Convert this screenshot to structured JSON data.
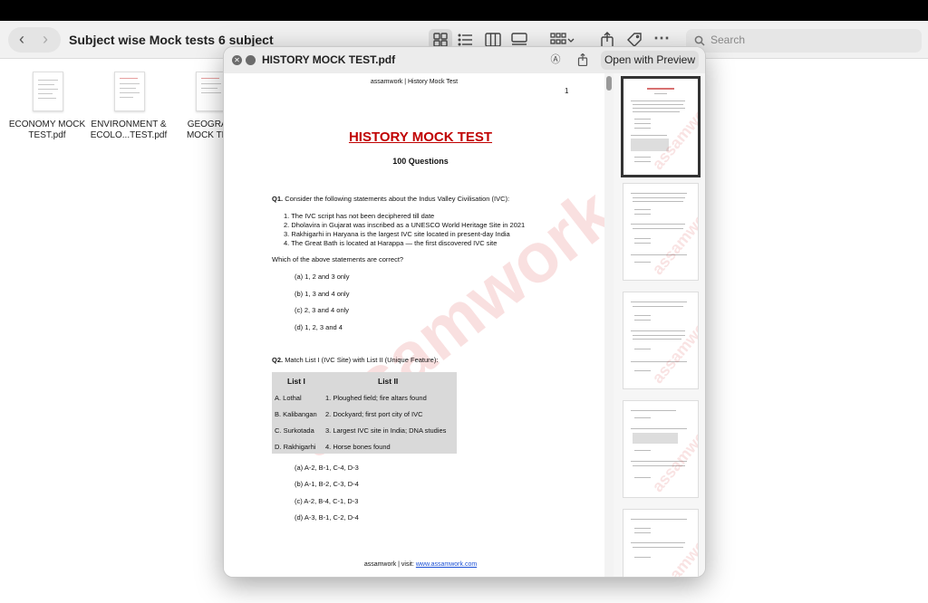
{
  "folder": {
    "title": "Subject wise Mock tests 6 subject"
  },
  "toolbar": {
    "search_placeholder": "Search"
  },
  "files": [
    {
      "line1": "ECONOMY MOCK",
      "line2": "TEST.pdf"
    },
    {
      "line1": "ENVIRONMENT &",
      "line2": "ECOLO...TEST.pdf"
    },
    {
      "line1": "GEOGRAP",
      "line2": "MOCK TES"
    }
  ],
  "quicklook": {
    "title": "HISTORY MOCK TEST.pdf",
    "open_with": "Open with Preview"
  },
  "document": {
    "header": "assamwork | History Mock Test",
    "page_number": "1",
    "title": "HISTORY MOCK TEST",
    "subtitle": "100 Questions",
    "watermark": "assamwork",
    "q1": {
      "prompt_num": "Q1.",
      "prompt": "Consider the following statements about the Indus Valley Civilisation (IVC):",
      "statements": [
        "1.   The IVC script has not been deciphered till date",
        "2.   Dholavira in Gujarat was inscribed as a UNESCO World Heritage Site in 2021",
        "3.   Rakhigarhi in Haryana is the largest IVC site located in present-day India",
        "4.   The Great Bath is located at Harappa — the first discovered IVC site"
      ],
      "ask": "Which of the above statements are correct?",
      "options": [
        "(a) 1, 2 and 3 only",
        "(b) 1, 3 and 4 only",
        "(c) 2, 3 and 4 only",
        "(d) 1, 2, 3 and 4"
      ]
    },
    "q2": {
      "prompt_num": "Q2.",
      "prompt": "Match List I (IVC Site) with List II (Unique Feature):",
      "col1": "List I",
      "col2": "List II",
      "rows": [
        {
          "a": "A. Lothal",
          "b": "1. Ploughed field; fire altars found"
        },
        {
          "a": "B. Kalibangan",
          "b": "2. Dockyard; first port city of IVC"
        },
        {
          "a": "C. Surkotada",
          "b": "3. Largest IVC site in India; DNA studies"
        },
        {
          "a": "D. Rakhigarhi",
          "b": "4. Horse bones found"
        }
      ],
      "options": [
        "(a) A-2, B-1, C-4, D-3",
        "(b) A-1, B-2, C-3, D-4",
        "(c) A-2, B-4, C-1, D-3",
        "(d) A-3, B-1, C-2, D-4"
      ]
    },
    "footer_prefix": "assamwork | visit: ",
    "footer_link": "www.assamwork.com"
  }
}
